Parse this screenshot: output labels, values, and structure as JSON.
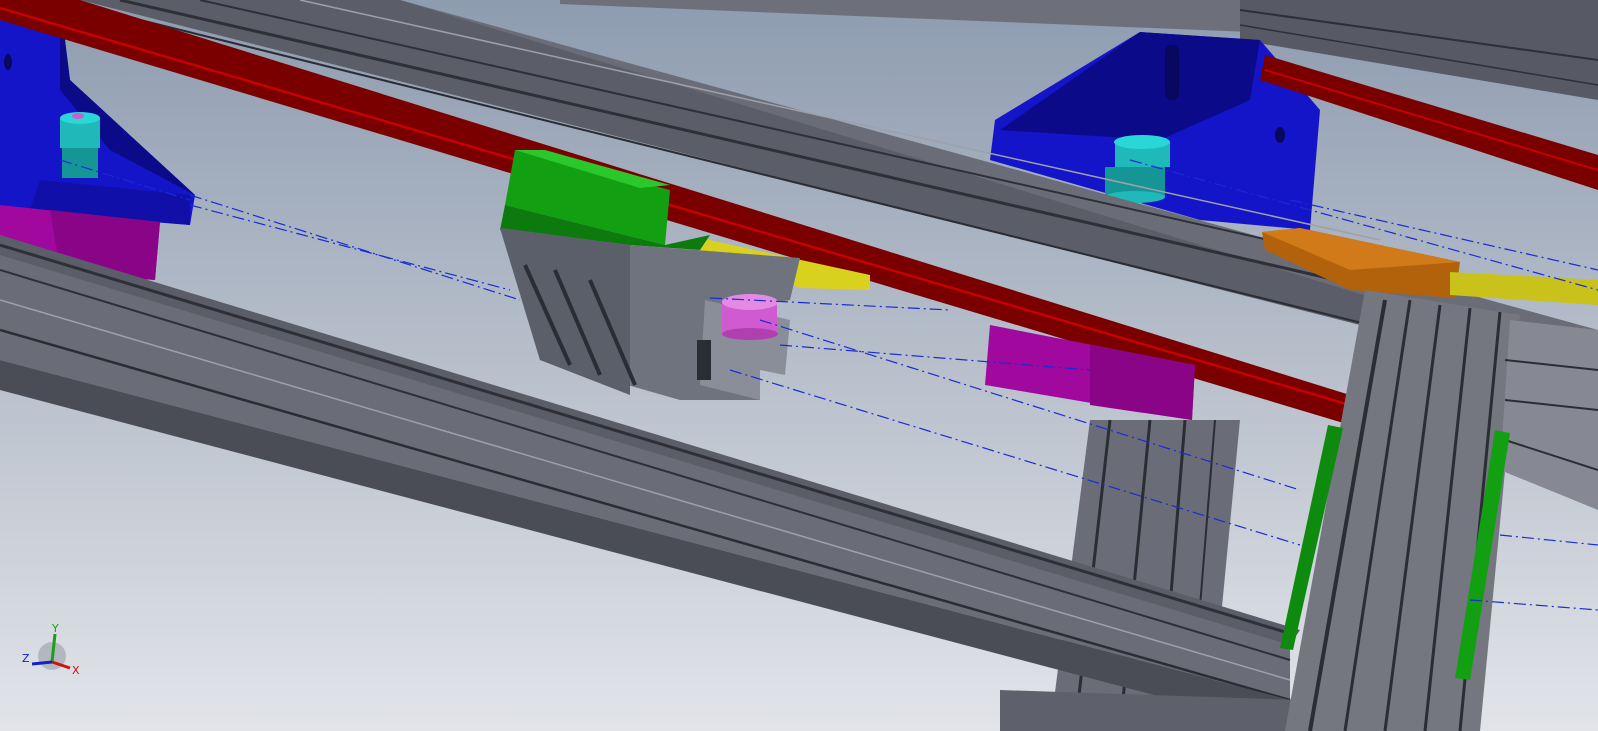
{
  "viewport": {
    "type": "3d-cad-model-view",
    "background_gradient": [
      "#8f9db1",
      "#c5cbd4",
      "#e3e5ea"
    ]
  },
  "colors": {
    "extrusion": "#5f626c",
    "extrusion_dark": "#3f414a",
    "extrusion_light": "#8c8f99",
    "rail": "#7a0000",
    "rail_highlight": "#c80000",
    "bracket_blue": "#1414c8",
    "bracket_blue_dark": "#0b0b8a",
    "motor_magenta": "#a0089e",
    "carriage_green": "#12a012",
    "carriage_grey": "#6f737e",
    "pulley_teal": "#1fb9b9",
    "pulley_pink": "#d05ad0",
    "plate_orange": "#b2620a",
    "bar_yellow": "#c9c21a",
    "belt_line": "#1a2bd6"
  },
  "triad": {
    "x_label": "X",
    "y_label": "Y",
    "z_label": "Z",
    "x_color": "#c81414",
    "y_color": "#18a018",
    "z_color": "#1420c8"
  }
}
